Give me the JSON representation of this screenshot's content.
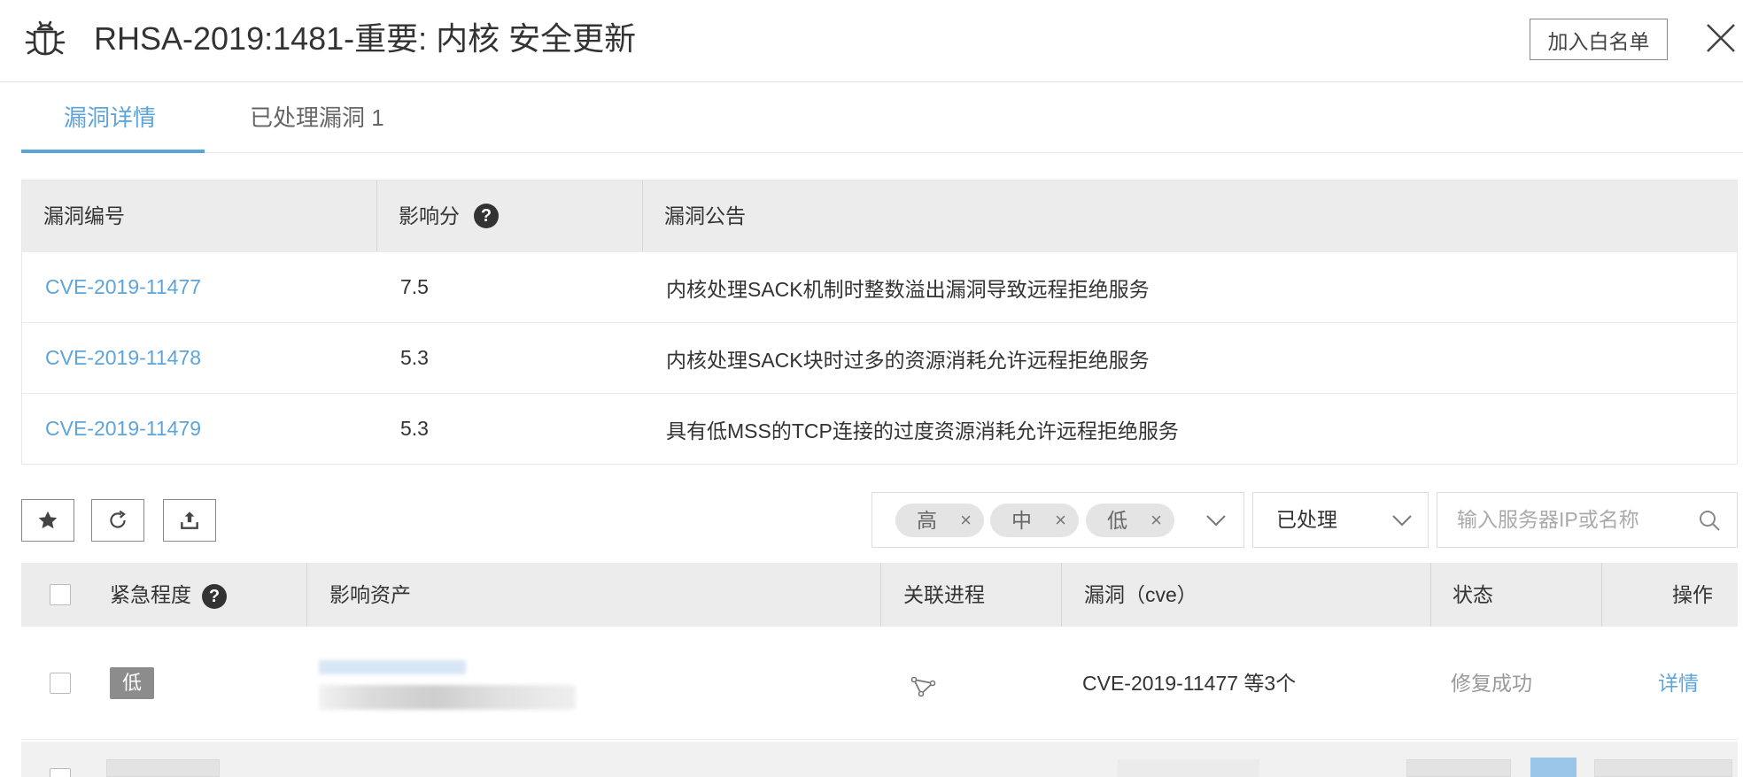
{
  "header": {
    "title": "RHSA-2019:1481-重要: 内核 安全更新",
    "whitelist_button": "加入白名单",
    "icon": "bug-icon",
    "close_icon": "close-icon"
  },
  "tabs": [
    {
      "label": "漏洞详情",
      "active": true
    },
    {
      "label": "已处理漏洞 1",
      "active": false
    }
  ],
  "cve_table": {
    "columns": [
      "漏洞编号",
      "影响分",
      "漏洞公告"
    ],
    "rows": [
      {
        "id": "CVE-2019-11477",
        "score": "7.5",
        "notice": "内核处理SACK机制时整数溢出漏洞导致远程拒绝服务"
      },
      {
        "id": "CVE-2019-11478",
        "score": "5.3",
        "notice": "内核处理SACK块时过多的资源消耗允许远程拒绝服务"
      },
      {
        "id": "CVE-2019-11479",
        "score": "5.3",
        "notice": "具有低MSS的TCP连接的过度资源消耗允许远程拒绝服务"
      }
    ]
  },
  "filters": {
    "level_tags": [
      "高",
      "中",
      "低"
    ],
    "status_value": "已处理",
    "search_placeholder": "输入服务器IP或名称"
  },
  "asset_table": {
    "columns": [
      "紧急程度",
      "影响资产",
      "关联进程",
      "漏洞（cve）",
      "状态",
      "操作"
    ],
    "rows": [
      {
        "level": "低",
        "cve": "CVE-2019-11477 等3个",
        "status": "修复成功",
        "action": "详情"
      }
    ]
  },
  "colors": {
    "accent": "#5da5d9",
    "header_bg": "#ececec",
    "badge_low": "#8c8c8c"
  }
}
